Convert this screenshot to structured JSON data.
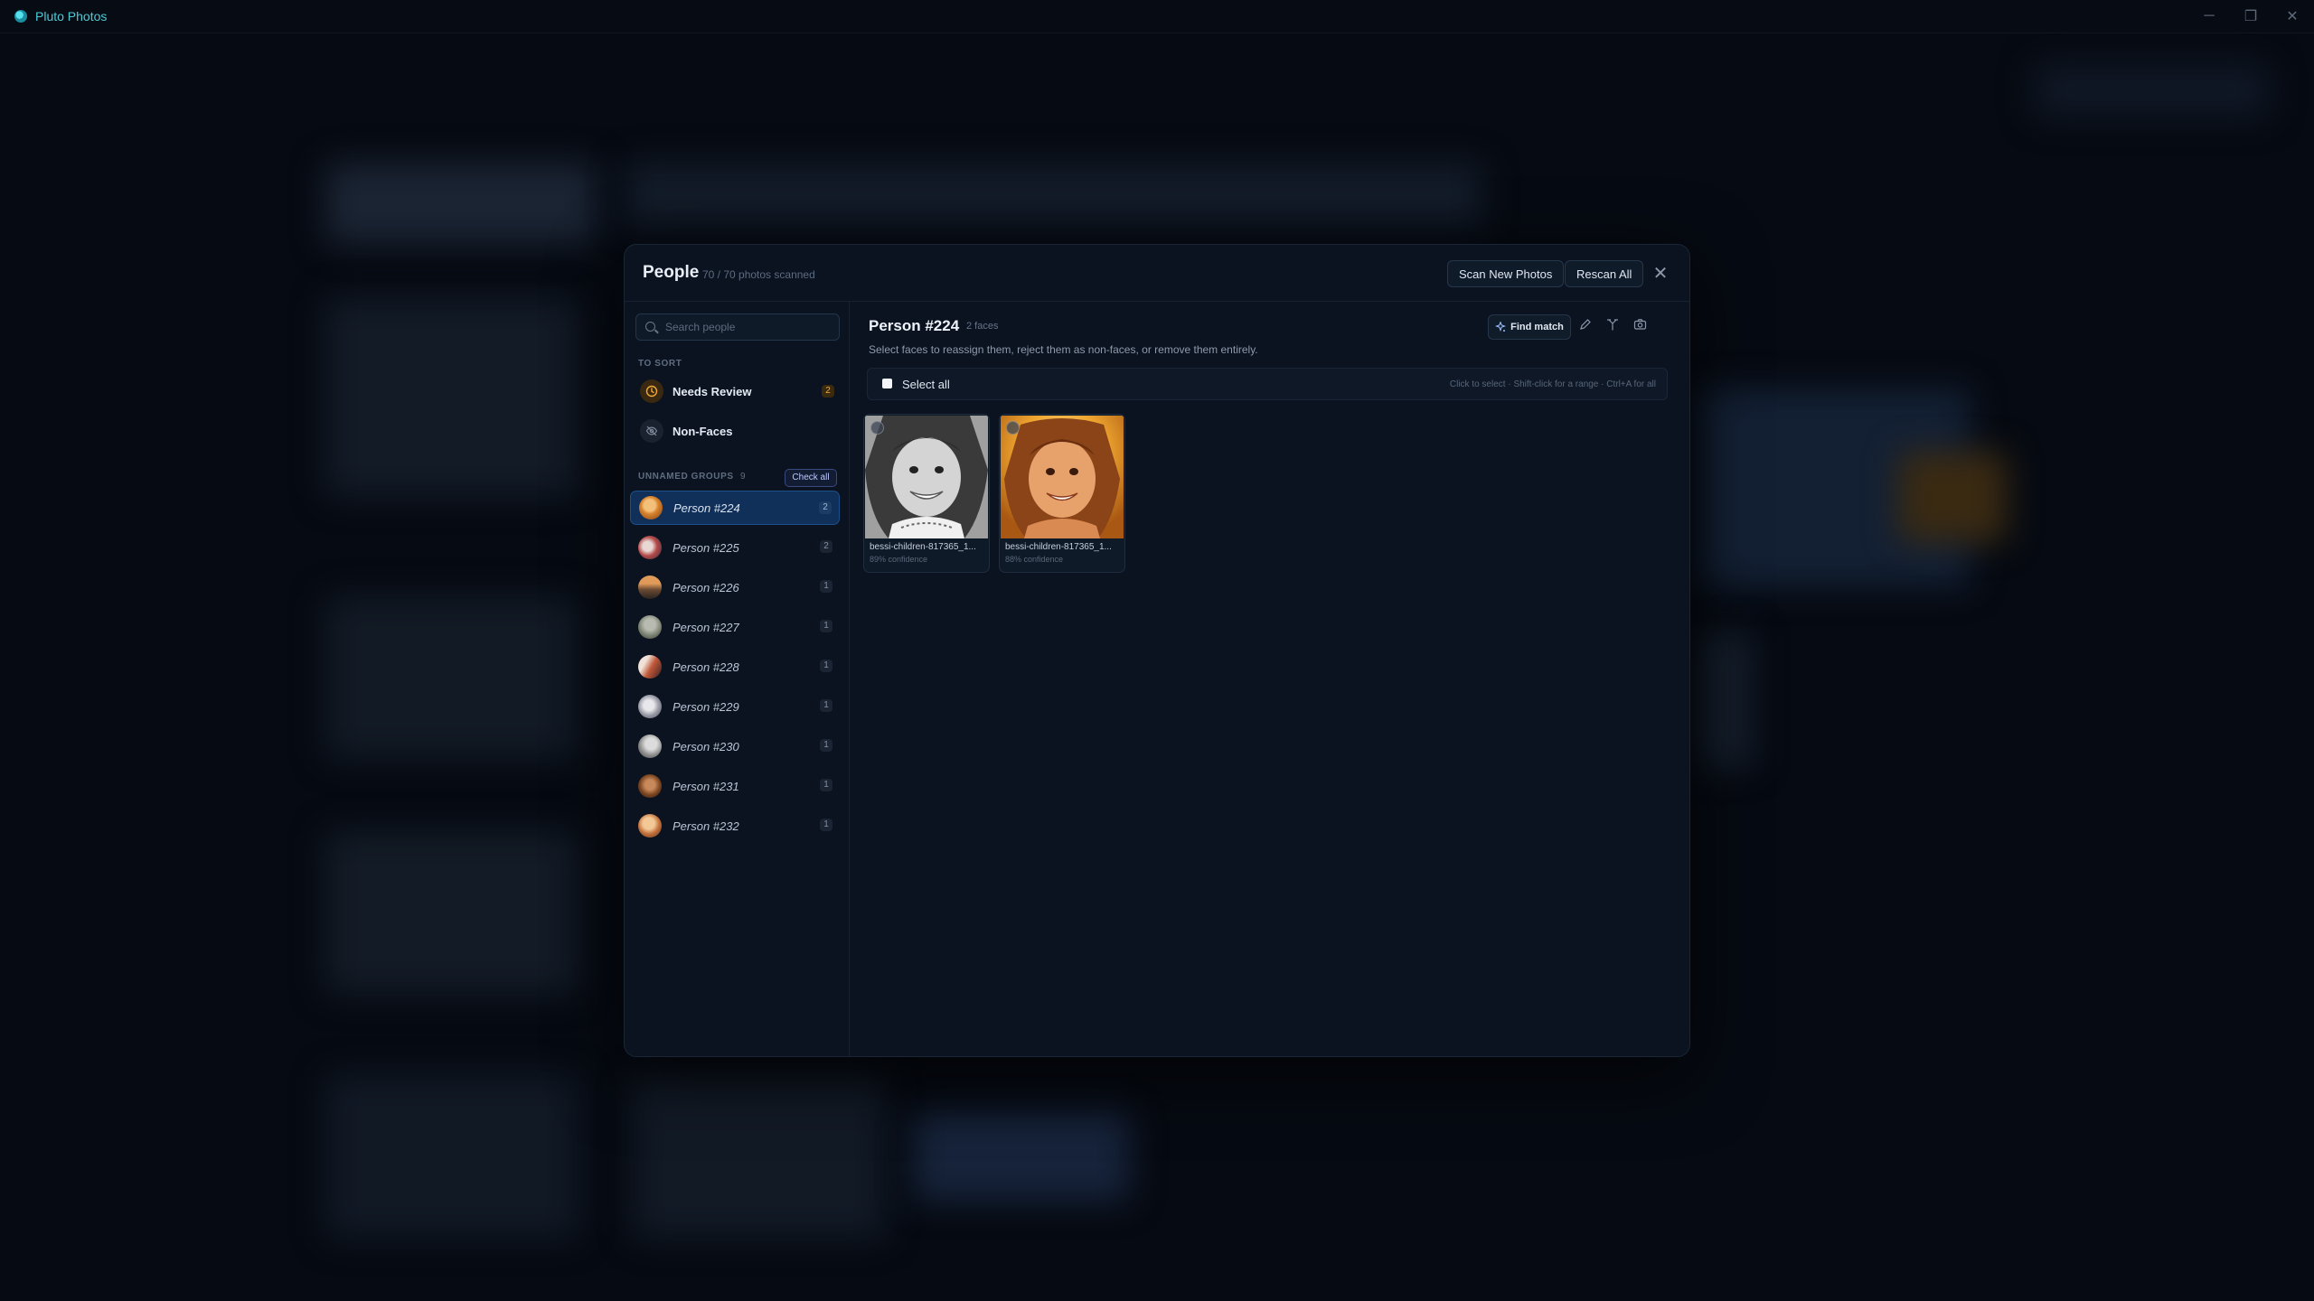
{
  "app": {
    "name": "Pluto Photos"
  },
  "window_controls": {
    "minimize": "─",
    "maximize": "❐",
    "close": "✕"
  },
  "modal": {
    "title": "People",
    "subtitle": "70 / 70 photos scanned",
    "scan_new_label": "Scan New Photos",
    "rescan_all_label": "Rescan All",
    "close_glyph": "✕"
  },
  "sidebar": {
    "search_placeholder": "Search people",
    "to_sort_label": "TO SORT",
    "needs_review": {
      "label": "Needs Review",
      "count": "2"
    },
    "non_faces": {
      "label": "Non-Faces"
    },
    "unnamed_groups_label": "UNNAMED GROUPS",
    "unnamed_groups_count": "9",
    "check_all_label": "Check all",
    "people": [
      {
        "label": "Person #224",
        "count": "2"
      },
      {
        "label": "Person #225",
        "count": "2"
      },
      {
        "label": "Person #226",
        "count": "1"
      },
      {
        "label": "Person #227",
        "count": "1"
      },
      {
        "label": "Person #228",
        "count": "1"
      },
      {
        "label": "Person #229",
        "count": "1"
      },
      {
        "label": "Person #230",
        "count": "1"
      },
      {
        "label": "Person #231",
        "count": "1"
      },
      {
        "label": "Person #232",
        "count": "1"
      }
    ]
  },
  "main": {
    "title": "Person #224",
    "face_count": "2 faces",
    "description": "Select faces to reassign them, reject them as non-faces, or remove them entirely.",
    "find_match_label": "Find match",
    "select_all_label": "Select all",
    "select_hint": "Click to select · Shift-click for a range · Ctrl+A for all",
    "faces": [
      {
        "filename": "bessi-children-817365_1...",
        "confidence": "89% confidence"
      },
      {
        "filename": "bessi-children-817365_1...",
        "confidence": "88% confidence"
      }
    ]
  },
  "colors": {
    "accent": "#4fc9d6",
    "active_item": "#10305a",
    "warning": "#f0a936"
  }
}
